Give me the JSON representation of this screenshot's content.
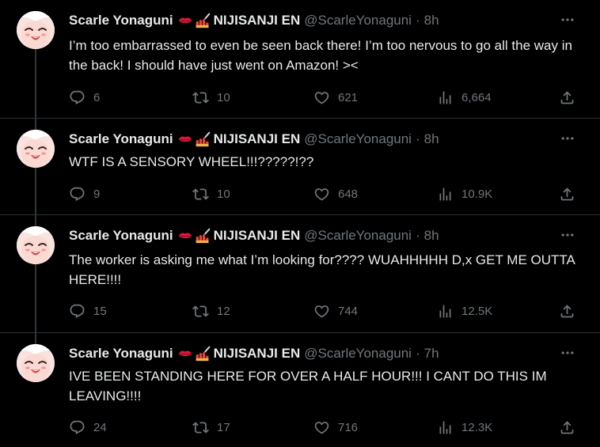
{
  "colors": {
    "background": "#000000",
    "text": "#e7e9ea",
    "muted": "#71767b",
    "separator": "#2f3336"
  },
  "tweets": [
    {
      "name": "Scarle Yonaguni",
      "affiliation": "NIJISANJI EN",
      "handle": "@ScarleYonaguni",
      "dot": "·",
      "time": "8h",
      "text": "I’m too embarrassed to even be seen back there! I’m too nervous to go all the way in the back! I should have just went on Amazon! ><",
      "replies": "6",
      "retweets": "10",
      "likes": "621",
      "views": "6,664"
    },
    {
      "name": "Scarle Yonaguni",
      "affiliation": "NIJISANJI EN",
      "handle": "@ScarleYonaguni",
      "dot": "·",
      "time": "8h",
      "text": "WTF IS A SENSORY WHEEL!!!?????!??",
      "replies": "9",
      "retweets": "10",
      "likes": "648",
      "views": "10.9K"
    },
    {
      "name": "Scarle Yonaguni",
      "affiliation": "NIJISANJI EN",
      "handle": "@ScarleYonaguni",
      "dot": "·",
      "time": "8h",
      "text": "The worker is asking me what I’m looking for???? WUAHHHHH D,x GET ME OUTTA HERE!!!!",
      "replies": "15",
      "retweets": "12",
      "likes": "744",
      "views": "12.5K"
    },
    {
      "name": "Scarle Yonaguni",
      "affiliation": "NIJISANJI EN",
      "handle": "@ScarleYonaguni",
      "dot": "·",
      "time": "7h",
      "text": "IVE BEEN STANDING HERE FOR OVER A HALF HOUR!!! I CANT DO THIS IM LEAVING!!!!",
      "replies": "24",
      "retweets": "17",
      "likes": "716",
      "views": "12.3K"
    }
  ]
}
